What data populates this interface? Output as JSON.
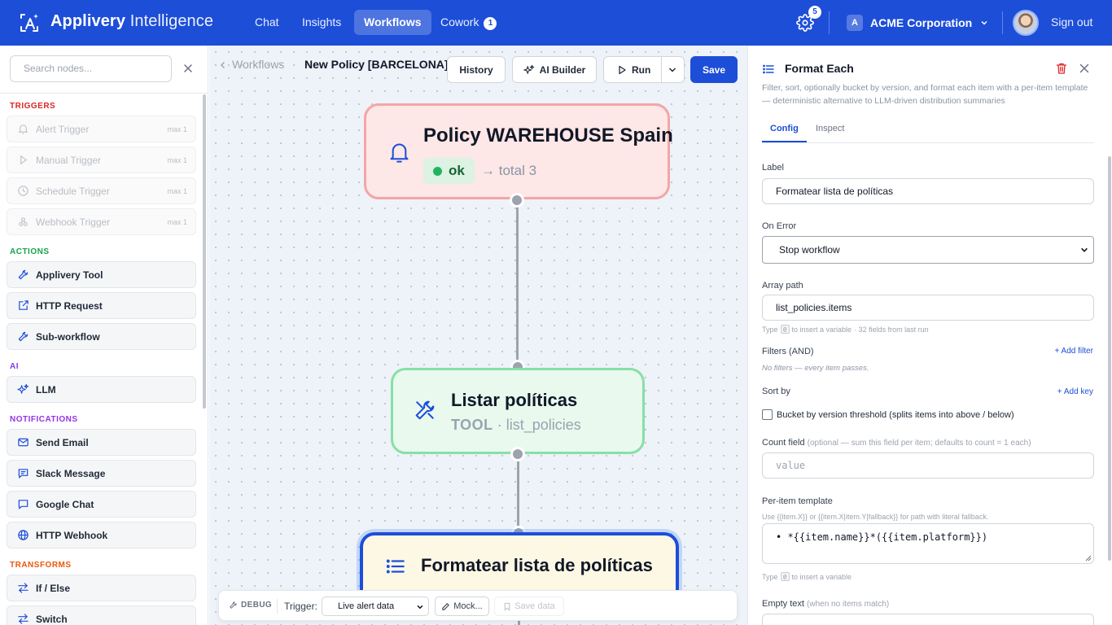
{
  "topbar": {
    "brand_bold": "Applivery",
    "brand_light": "Intelligence",
    "nav": [
      {
        "label": "Chat"
      },
      {
        "label": "Insights"
      },
      {
        "label": "Workflows"
      },
      {
        "label": "Cowork",
        "badge": "1"
      }
    ],
    "settings_badge": "5",
    "org_initial": "A",
    "org_name": "ACME Corporation",
    "sign_out": "Sign out",
    "color": "#1d4ed8"
  },
  "sidebar": {
    "search_placeholder": "Search nodes...",
    "sections": {
      "triggers": {
        "label": "TRIGGERS",
        "color": "#dc2626"
      },
      "actions": {
        "label": "ACTIONS",
        "color": "#16a34a"
      },
      "ai": {
        "label": "AI",
        "color": "#7c3aed"
      },
      "notifications": {
        "label": "NOTIFICATIONS",
        "color": "#9333ea"
      },
      "transforms": {
        "label": "TRANSFORMS",
        "color": "#ea580c"
      }
    },
    "triggers": [
      {
        "label": "Alert Trigger",
        "max": "max 1",
        "icon": "bell-icon"
      },
      {
        "label": "Manual Trigger",
        "max": "max 1",
        "icon": "play-icon"
      },
      {
        "label": "Schedule Trigger",
        "max": "max 1",
        "icon": "clock-icon"
      },
      {
        "label": "Webhook Trigger",
        "max": "max 1",
        "icon": "webhook-icon"
      }
    ],
    "actions": [
      {
        "label": "Applivery Tool",
        "icon": "wrench-icon"
      },
      {
        "label": "HTTP Request",
        "icon": "external-link-icon"
      },
      {
        "label": "Sub-workflow",
        "icon": "wrench-icon"
      }
    ],
    "ai": [
      {
        "label": "LLM",
        "icon": "sparkle-icon"
      }
    ],
    "notifications": [
      {
        "label": "Send Email",
        "icon": "mail-icon"
      },
      {
        "label": "Slack Message",
        "icon": "message-icon"
      },
      {
        "label": "Google Chat",
        "icon": "chat-icon"
      },
      {
        "label": "HTTP Webhook",
        "icon": "globe-icon"
      }
    ],
    "transforms": [
      {
        "label": "If / Else",
        "icon": "arrows-icon"
      },
      {
        "label": "Switch",
        "icon": "arrows-icon"
      }
    ]
  },
  "canvas": {
    "breadcrumb": "Workflows",
    "policy_name": "New Policy [BARCELONA]",
    "history_label": "History",
    "ai_builder_label": "AI Builder",
    "run_label": "Run",
    "save_label": "Save",
    "nodes": {
      "trigger": {
        "title": "Policy WAREHOUSE Spain",
        "status": "ok",
        "total": "→ total 3",
        "icon": "bell-icon"
      },
      "tool": {
        "title": "Listar políticas",
        "kind": "TOOL",
        "sep": "·",
        "tool_name": "list_policies",
        "icon": "wrench-icon"
      },
      "format": {
        "title": "Formatear lista de políticas",
        "icon": "list-icon"
      }
    },
    "debug": {
      "label": "DEBUG",
      "trigger_label": "Trigger:",
      "trigger_value": "Live alert data",
      "mock_label": "Mock...",
      "save_data_label": "Save data"
    }
  },
  "panel": {
    "title": "Format Each",
    "description": "Filter, sort, optionally bucket by version, and format each item with a per-item template — deterministic alternative to LLM-driven distribution summaries",
    "tabs": [
      {
        "label": "Config"
      },
      {
        "label": "Inspect"
      }
    ],
    "label_field": {
      "label": "Label",
      "value": "Formatear lista de políticas"
    },
    "on_error": {
      "label": "On Error",
      "value": "Stop workflow"
    },
    "array_path": {
      "label": "Array path",
      "value": "list_policies.items",
      "hint_pre": "Type",
      "hint_key": "@",
      "hint_post": "to insert a variable",
      "hint_extra": "· 32 fields from last run"
    },
    "filters": {
      "label": "Filters (AND)",
      "add": "+ Add filter",
      "empty": "No filters — every item passes."
    },
    "sort": {
      "label": "Sort by",
      "add": "+ Add key"
    },
    "bucket": {
      "label": "Bucket by version threshold (splits items into above / below)",
      "checked": false
    },
    "count_field": {
      "label": "Count field",
      "note": "(optional — sum this field per item; defaults to count = 1 each)",
      "placeholder": "value"
    },
    "template": {
      "label": "Per-item template",
      "hint": "Use {{item.X}} or {{item.X|item.Y|fallback}} for path with literal fallback.",
      "value": "• *{{item.name}}*({{item.platform}})",
      "hint_pre": "Type",
      "hint_key": "@",
      "hint_post": "to insert a variable"
    },
    "empty_text": {
      "label": "Empty text",
      "note": "(when no items match)"
    }
  }
}
